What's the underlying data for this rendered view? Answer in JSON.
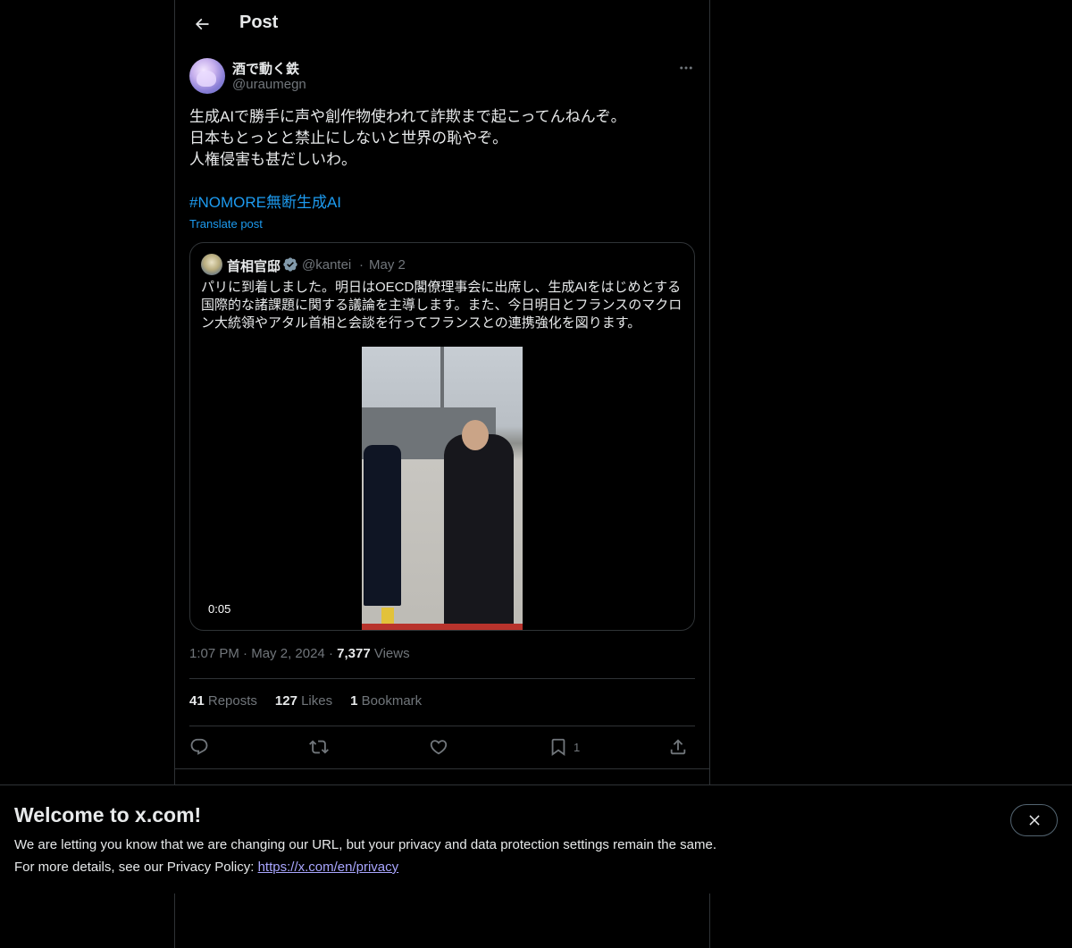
{
  "header": {
    "title": "Post"
  },
  "post": {
    "author_name": "酒で動く鉄",
    "author_handle": "@uraumegn",
    "text": "生成AIで勝手に声や創作物使われて詐欺まで起こってんねんぞ。\n日本もとっとと禁止にしないと世界の恥やぞ。\n人権侵害も甚だしいわ。",
    "hashtag": "#NOMORE無断生成AI",
    "translate_label": "Translate post",
    "time": "1:07 PM",
    "date": "May 2, 2024",
    "views_count": "7,377",
    "views_label": "Views"
  },
  "quote": {
    "author_name": "首相官邸",
    "author_handle": "@kantei",
    "date": "May 2",
    "text": "パリに到着しました。明日はOECD閣僚理事会に出席し、生成AIをはじめとする国際的な諸課題に関する議論を主導します。また、今日明日とフランスのマクロン大統領やアタル首相と会談を行ってフランスとの連携強化を図ります。",
    "video_duration": "0:05"
  },
  "stats": {
    "reposts_count": "41",
    "reposts_label": "Reposts",
    "likes_count": "127",
    "likes_label": "Likes",
    "bookmarks_count": "1",
    "bookmarks_label": "Bookmark"
  },
  "actions": {
    "bookmark_count": "1"
  },
  "banner": {
    "title": "Welcome to x.com!",
    "line1": "We are letting you know that we are changing our URL, but your privacy and data protection settings remain the same.",
    "line2_prefix": "For more details, see our Privacy Policy: ",
    "link": "https://x.com/en/privacy"
  },
  "colors": {
    "accent": "#1d9bf0",
    "link": "#a9a6ff",
    "muted": "#71767b",
    "border": "#2f3336"
  }
}
